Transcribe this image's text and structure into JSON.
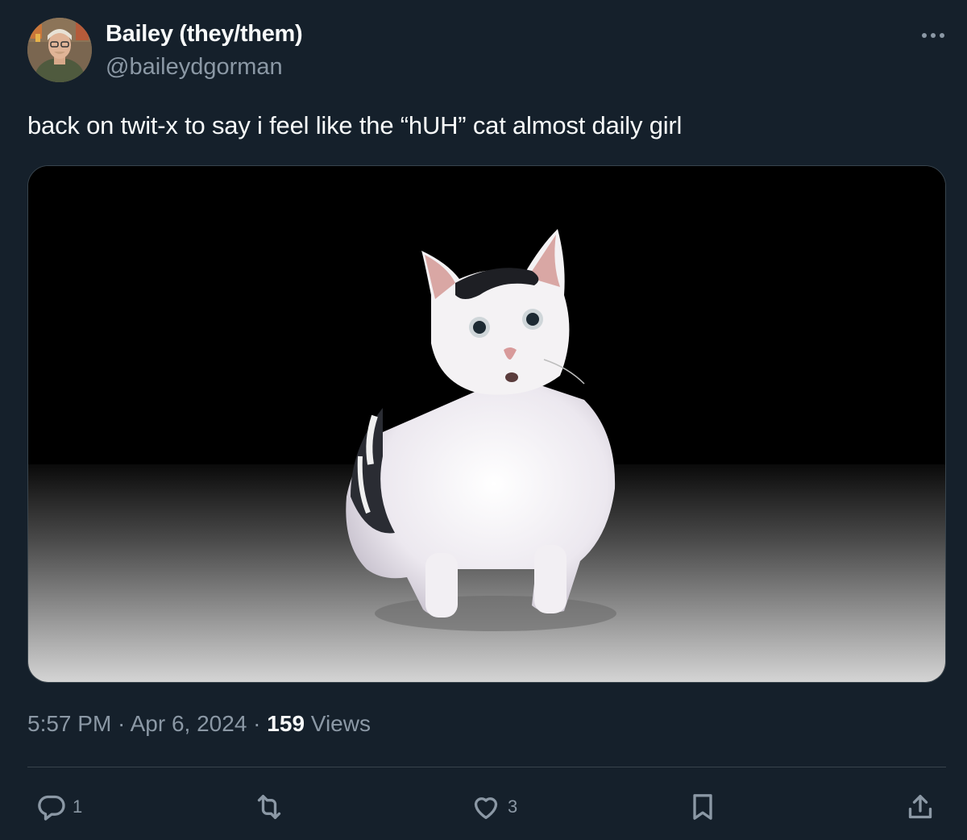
{
  "author": {
    "display_name": "Bailey (they/them)",
    "handle": "@baileydgorman",
    "avatar_icon": "avatar-photo"
  },
  "tweet": {
    "text": "back on twit-x to say i feel like the “hUH” cat almost daily girl",
    "media_description_icon": "cat-photo"
  },
  "meta": {
    "time": "5:57 PM",
    "sep1": " · ",
    "date": "Apr 6, 2024",
    "sep2": " · ",
    "views_count": "159",
    "views_label": " Views"
  },
  "actions": {
    "reply_count": "1",
    "repost_count": "",
    "like_count": "3"
  },
  "colors": {
    "background": "#15202b",
    "text_primary": "#f7f9f9",
    "text_secondary": "#8b98a5",
    "divider": "#38444d"
  }
}
